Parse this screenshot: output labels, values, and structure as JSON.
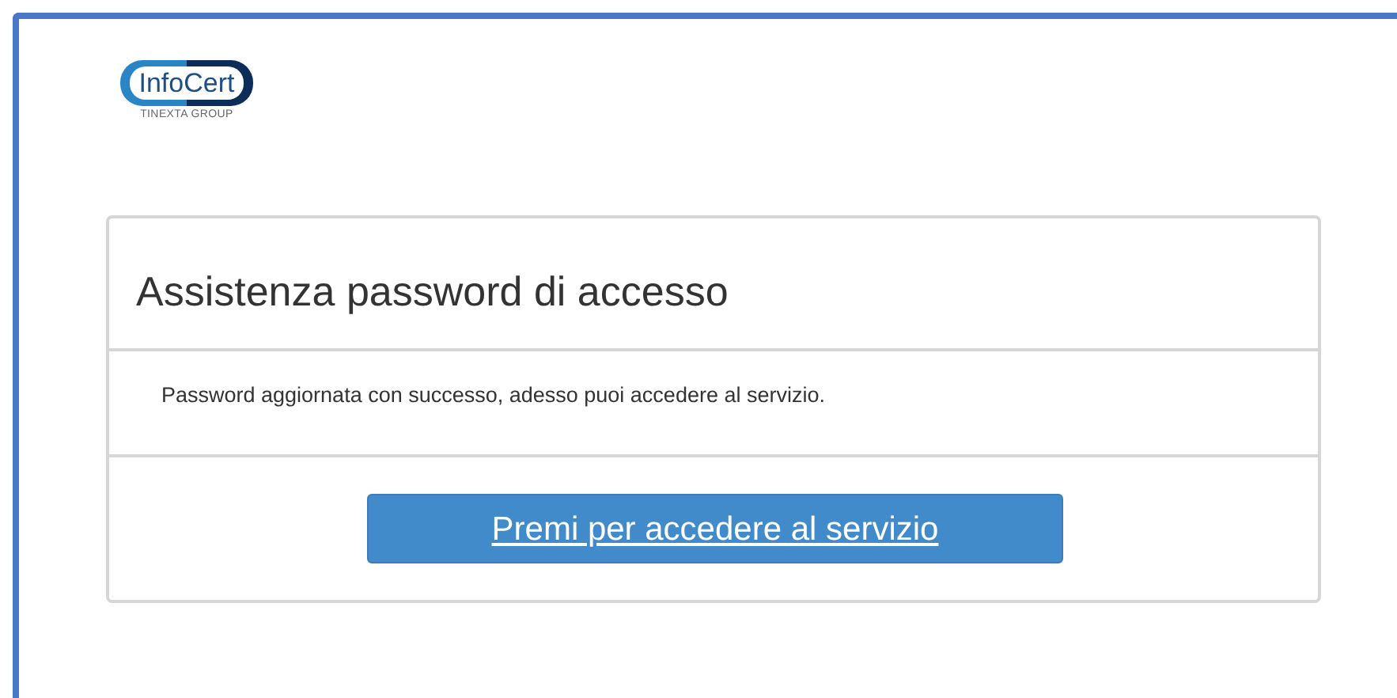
{
  "logo": {
    "name": "InfoCert",
    "tagline": "TINEXTA GROUP"
  },
  "card": {
    "title": "Assistenza password di accesso",
    "message": "Password aggiornata con successo, adesso puoi accedere al servizio.",
    "button": "Premi per accedere al servizio"
  }
}
